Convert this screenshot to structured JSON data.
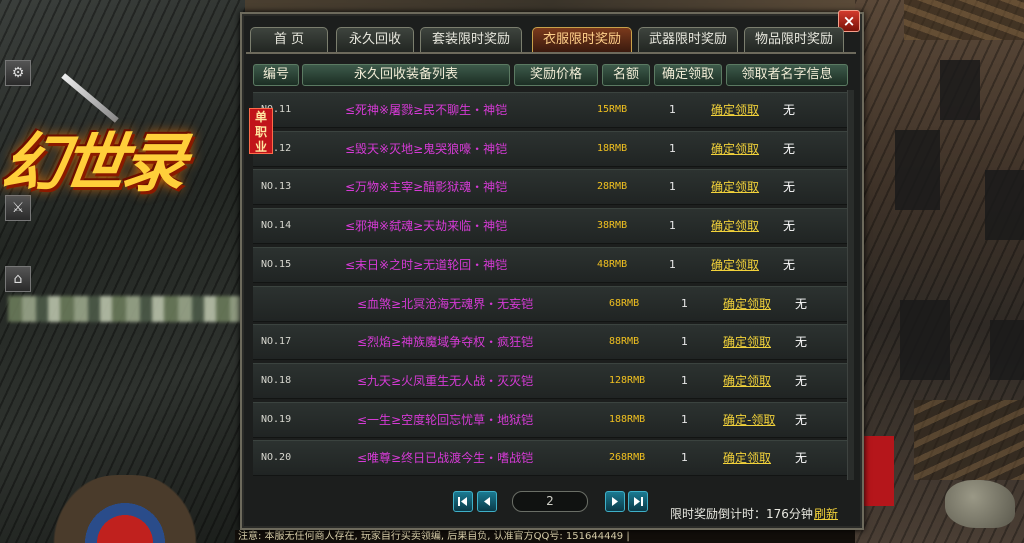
{
  "logo": {
    "text": "幻世录"
  },
  "tabs": [
    {
      "label": "首 页"
    },
    {
      "label": "永久回收"
    },
    {
      "label": "套装限时奖励"
    },
    {
      "label": "衣服限时奖励",
      "active": true
    },
    {
      "label": "武器限时奖励"
    },
    {
      "label": "物品限时奖励"
    }
  ],
  "close_label": "×",
  "table": {
    "headers": [
      "编号",
      "永久回收装备列表",
      "奖励价格",
      "名额",
      "确定领取",
      "领取者名字信息"
    ],
    "badge": "单职业",
    "rows": [
      {
        "no": "NO.11",
        "name": "≤死神※屠戮≥民不聊生・神铠",
        "price": "15RMB",
        "qty": "1",
        "claim": "确定领取",
        "claimer": "无"
      },
      {
        "no": "NO.12",
        "name": "≤毁天※灭地≥鬼哭狼嚎・神铠",
        "price": "18RMB",
        "qty": "1",
        "claim": "确定领取",
        "claimer": "无"
      },
      {
        "no": "NO.13",
        "name": "≤万物※主宰≥醋影狱魂・神铠",
        "price": "28RMB",
        "qty": "1",
        "claim": "确定领取",
        "claimer": "无"
      },
      {
        "no": "NO.14",
        "name": "≤邪神※弑魂≥天劫来临・神铠",
        "price": "38RMB",
        "qty": "1",
        "claim": "确定领取",
        "claimer": "无"
      },
      {
        "no": "NO.15",
        "name": "≤末日※之时≥无道轮回・神铠",
        "price": "48RMB",
        "qty": "1",
        "claim": "确定领取",
        "claimer": "无"
      },
      {
        "no": "",
        "name": "≤血煞≥北冥沧海无魂界・无妄铠",
        "price": "68RMB",
        "qty": "1",
        "claim": "确定领取",
        "claimer": "无"
      },
      {
        "no": "NO.17",
        "name": "≤烈焰≥神族魔域争夺权・疯狂铠",
        "price": "88RMB",
        "qty": "1",
        "claim": "确定领取",
        "claimer": "无"
      },
      {
        "no": "NO.18",
        "name": "≤九天≥火凤重生无人战・灭灭铠",
        "price": "128RMB",
        "qty": "1",
        "claim": "确定领取",
        "claimer": "无"
      },
      {
        "no": "NO.19",
        "name": "≤一生≥空度轮回忘忧草・地狱铠",
        "price": "188RMB",
        "qty": "1",
        "claim": "确定-领取",
        "claimer": "无"
      },
      {
        "no": "NO.20",
        "name": "≤唯尊≥终日已战渡今生・嗜战铠",
        "price": "268RMB",
        "qty": "1",
        "claim": "确定领取",
        "claimer": "无"
      }
    ]
  },
  "pager": {
    "page": "2"
  },
  "countdown": {
    "label": "限时奖励倒计时：176分钟",
    "refresh": "刷新"
  },
  "bottom_notice": "注意: 本服无任何商人存在, 玩家自行买卖领编, 后果自负, 认准官方QQ号: 151644449 |",
  "colors": {
    "item_name": "#d63ad6",
    "price": "#f0c020",
    "claim_link": "#f2d23a",
    "active_tab": "#7b3a1c"
  }
}
